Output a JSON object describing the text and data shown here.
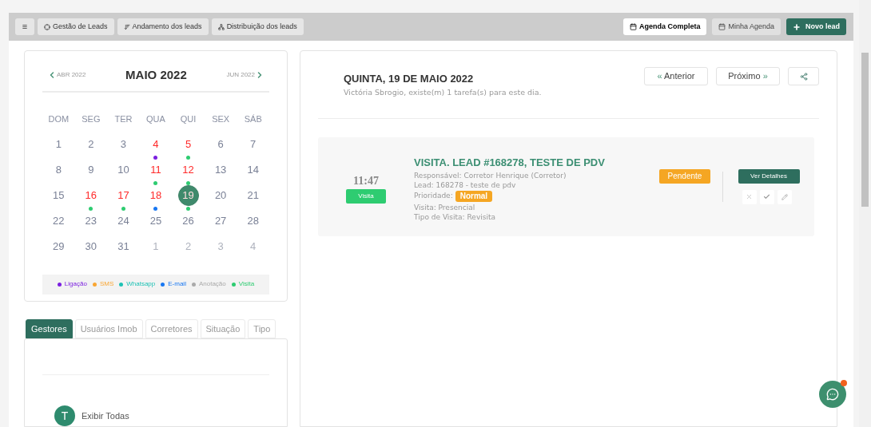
{
  "toolbar": {
    "menu_icon": "≡",
    "left_buttons": [
      {
        "label": "Gestão de Leads"
      },
      {
        "label": "Andamento dos leads"
      },
      {
        "label": "Distribuição dos leads"
      }
    ],
    "right_buttons": [
      {
        "label": "Agenda Completa",
        "kind": "view",
        "selected": true
      },
      {
        "label": "Minha Agenda",
        "kind": "view",
        "selected": false
      },
      {
        "label": "Novo lead",
        "kind": "primary"
      }
    ]
  },
  "calendar": {
    "prev": "ABR 2022",
    "title": "MAIO 2022",
    "next": "JUN 2022",
    "weekdays": [
      "DOM",
      "SEG",
      "TER",
      "QUA",
      "QUI",
      "SEX",
      "SÁB"
    ],
    "days": [
      {
        "day": "1",
        "muted": false,
        "has_task": false,
        "selected": false
      },
      {
        "day": "2",
        "muted": false,
        "has_task": false,
        "selected": false
      },
      {
        "day": "3",
        "muted": false,
        "has_task": false,
        "selected": false
      },
      {
        "day": "4",
        "muted": false,
        "has_task": true,
        "selected": false,
        "color": "#7b1fe0"
      },
      {
        "day": "5",
        "muted": false,
        "has_task": true,
        "selected": false,
        "color": "#2ecc71"
      },
      {
        "day": "6",
        "muted": false,
        "has_task": false,
        "selected": false
      },
      {
        "day": "7",
        "muted": false,
        "has_task": false,
        "selected": false
      },
      {
        "day": "8",
        "muted": false,
        "has_task": false,
        "selected": false
      },
      {
        "day": "9",
        "muted": false,
        "has_task": false,
        "selected": false
      },
      {
        "day": "10",
        "muted": false,
        "has_task": false,
        "selected": false
      },
      {
        "day": "11",
        "muted": false,
        "has_task": true,
        "selected": false,
        "color": "#2ecc71"
      },
      {
        "day": "12",
        "muted": false,
        "has_task": true,
        "selected": false,
        "color": "#2ecc71"
      },
      {
        "day": "13",
        "muted": false,
        "has_task": false,
        "selected": false
      },
      {
        "day": "14",
        "muted": false,
        "has_task": false,
        "selected": false
      },
      {
        "day": "15",
        "muted": false,
        "has_task": false,
        "selected": false
      },
      {
        "day": "16",
        "muted": false,
        "has_task": true,
        "selected": false,
        "color": "#2ecc71"
      },
      {
        "day": "17",
        "muted": false,
        "has_task": true,
        "selected": false,
        "color": "#2ecc71"
      },
      {
        "day": "18",
        "muted": false,
        "has_task": true,
        "selected": false,
        "color": "#1877f2"
      },
      {
        "day": "19",
        "muted": false,
        "has_task": true,
        "selected": true,
        "color": "#2ecc71"
      },
      {
        "day": "20",
        "muted": false,
        "has_task": false,
        "selected": false
      },
      {
        "day": "21",
        "muted": false,
        "has_task": false,
        "selected": false
      },
      {
        "day": "22",
        "muted": false,
        "has_task": false,
        "selected": false
      },
      {
        "day": "23",
        "muted": false,
        "has_task": false,
        "selected": false
      },
      {
        "day": "24",
        "muted": false,
        "has_task": false,
        "selected": false
      },
      {
        "day": "25",
        "muted": false,
        "has_task": false,
        "selected": false
      },
      {
        "day": "26",
        "muted": false,
        "has_task": false,
        "selected": false
      },
      {
        "day": "27",
        "muted": false,
        "has_task": false,
        "selected": false
      },
      {
        "day": "28",
        "muted": false,
        "has_task": false,
        "selected": false
      },
      {
        "day": "29",
        "muted": false,
        "has_task": false,
        "selected": false
      },
      {
        "day": "30",
        "muted": false,
        "has_task": false,
        "selected": false
      },
      {
        "day": "31",
        "muted": false,
        "has_task": false,
        "selected": false
      },
      {
        "day": "1",
        "muted": true,
        "has_task": false,
        "selected": false
      },
      {
        "day": "2",
        "muted": true,
        "has_task": false,
        "selected": false
      },
      {
        "day": "3",
        "muted": true,
        "has_task": false,
        "selected": false
      },
      {
        "day": "4",
        "muted": true,
        "has_task": false,
        "selected": false
      }
    ],
    "legend": [
      {
        "label": "Ligação",
        "color": "#7b1fe0"
      },
      {
        "label": "SMS",
        "color": "#f9a633"
      },
      {
        "label": "Whatsapp",
        "color": "#1fc2b5"
      },
      {
        "label": "E-mail",
        "color": "#1877f2"
      },
      {
        "label": "Anotação",
        "color": "#aaaaaa"
      },
      {
        "label": "Visita",
        "color": "#2ecc71"
      }
    ]
  },
  "filter_tabs": [
    {
      "label": "Gestores",
      "selected": true
    },
    {
      "label": "Usuários Imob",
      "selected": false
    },
    {
      "label": "Corretores",
      "selected": false
    },
    {
      "label": "Situação",
      "selected": false
    },
    {
      "label": "Tipo",
      "selected": false
    }
  ],
  "filter_list": [
    {
      "avatar": "T",
      "label": "Exibir Todas"
    }
  ],
  "day_view": {
    "title": "QUINTA, 19 DE MAIO 2022",
    "subtitle": "Victória Sbrogio, existe(m) 1 tarefa(s) para este dia.",
    "prev_button": {
      "glyph": "«",
      "label": "Anterior"
    },
    "next_button": {
      "glyph": "»",
      "label": "Próximo"
    },
    "tasks": [
      {
        "time": "11:47",
        "type_badge": "Visita",
        "title": "VISITA. LEAD #168278, TESTE DE PDV",
        "details": [
          "Responsável: Corretor Henrique (Corretor)",
          "Lead: 168278 - teste de pdv"
        ],
        "priority_label": "Prioridade:",
        "priority": "Normal",
        "details_after": [
          "Visita: Presencial",
          "Tipo de Visita: Revisita"
        ],
        "status": "Pendente",
        "details_button": "Ver Detalhes"
      }
    ]
  },
  "chat": {
    "unread": true
  }
}
